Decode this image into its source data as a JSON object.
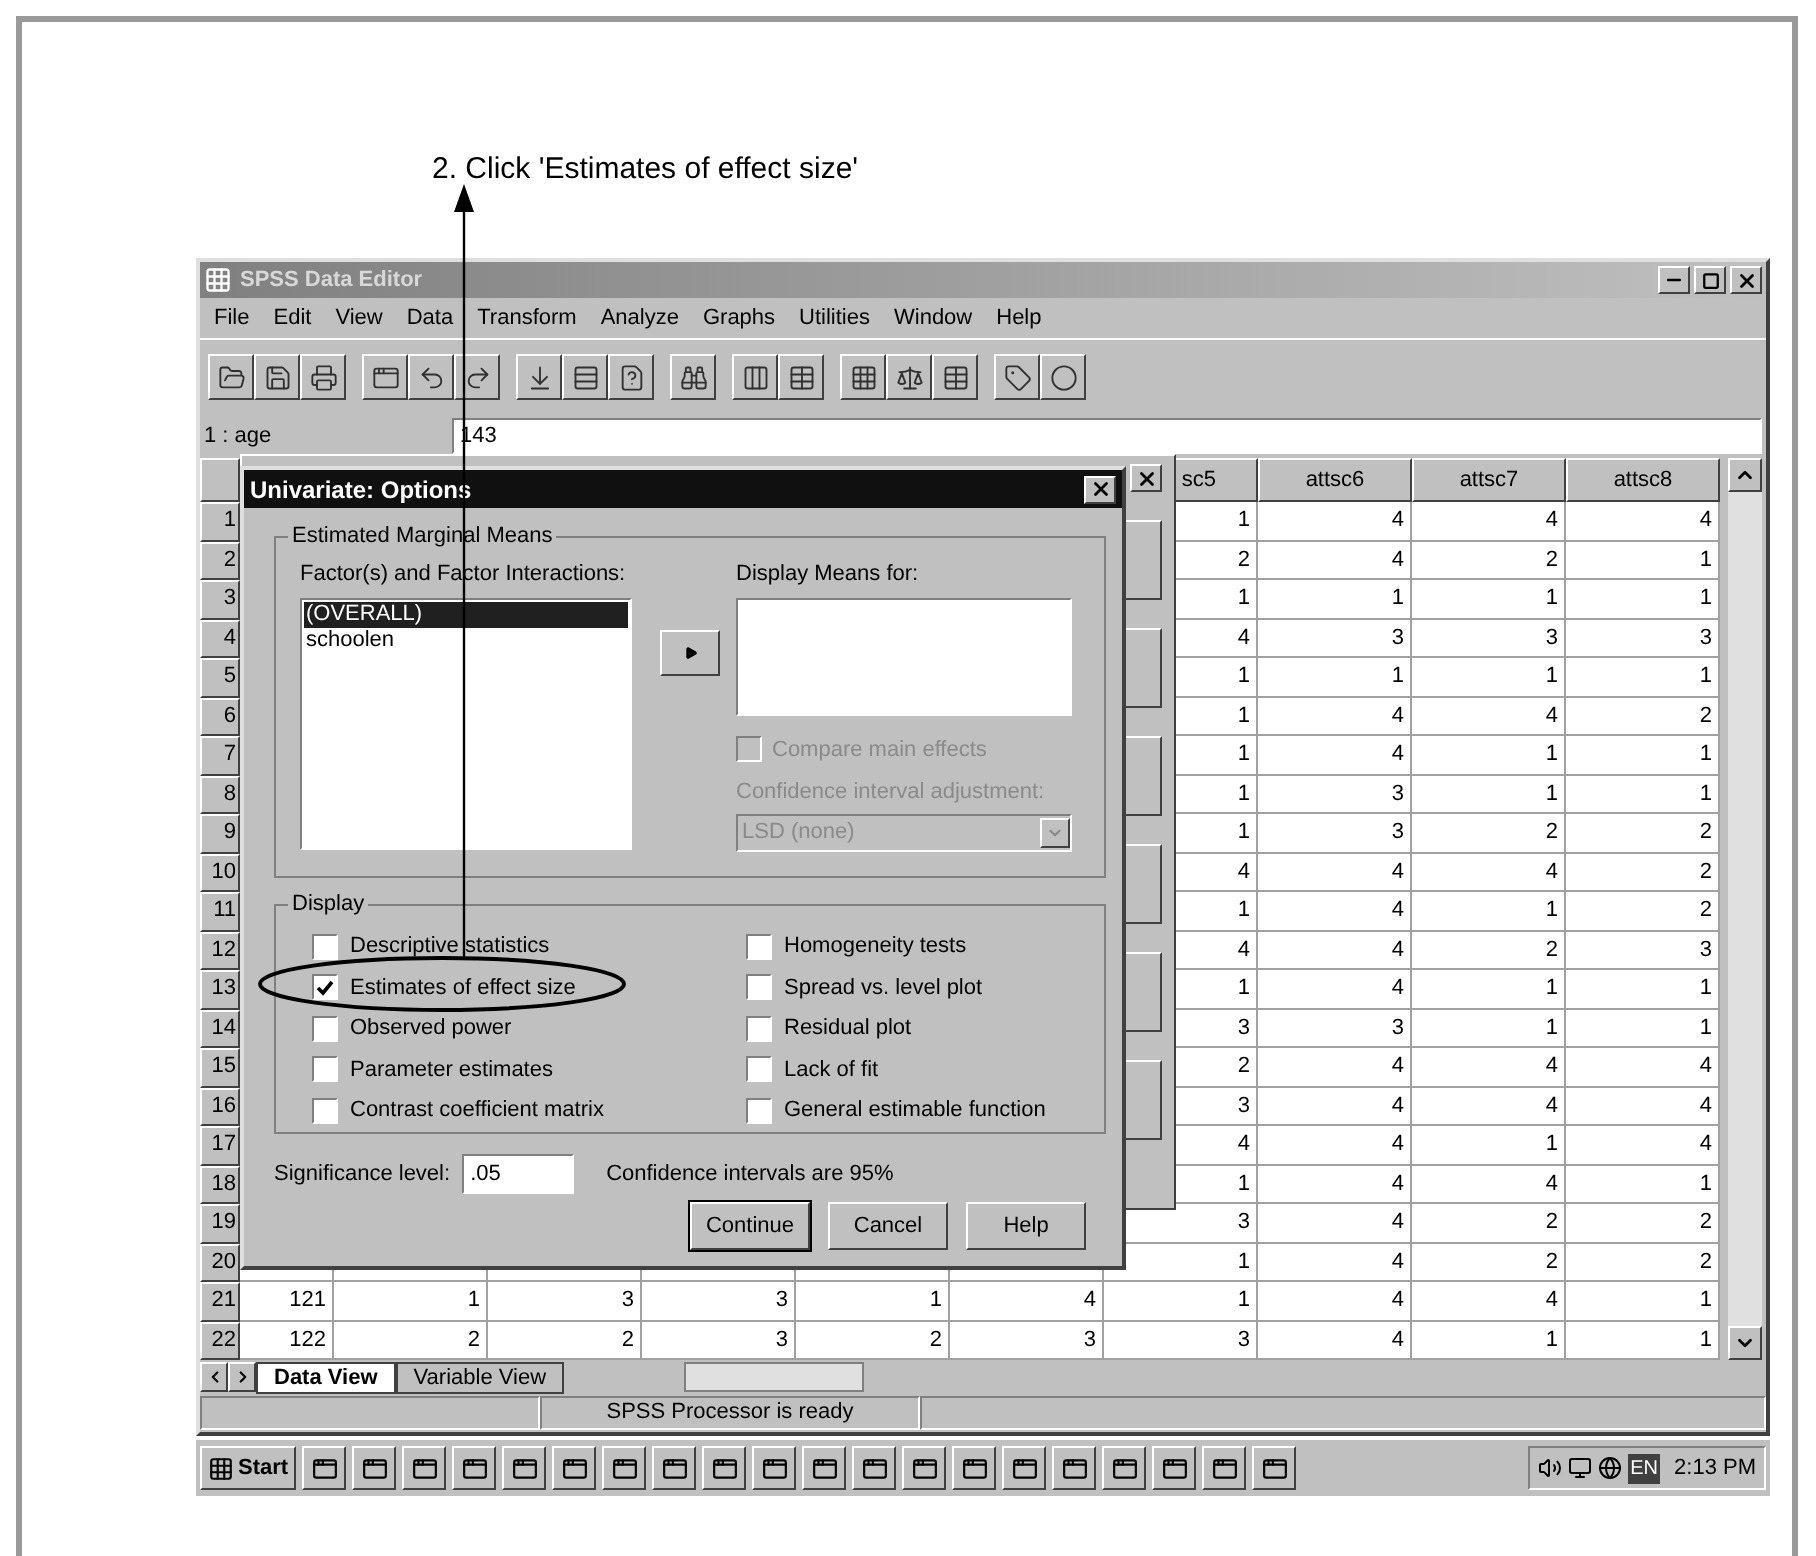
{
  "annotation": {
    "text": "2. Click 'Estimates of effect size'"
  },
  "window": {
    "title": "SPSS Data Editor"
  },
  "menu": [
    "File",
    "Edit",
    "View",
    "Data",
    "Transform",
    "Analyze",
    "Graphs",
    "Utilities",
    "Window",
    "Help"
  ],
  "cell_editor": {
    "cell": "1 : age",
    "value": "143"
  },
  "grid": {
    "columns": [
      "sc5",
      "attsc6",
      "attsc7",
      "attsc8"
    ],
    "rows": [
      {
        "number": "1",
        "cells": [
          "1",
          "4",
          "4",
          "4"
        ]
      },
      {
        "number": "2",
        "cells": [
          "2",
          "4",
          "2",
          "1"
        ]
      },
      {
        "number": "3",
        "cells": [
          "1",
          "1",
          "1",
          "1"
        ]
      },
      {
        "number": "4",
        "cells": [
          "4",
          "3",
          "3",
          "3"
        ]
      },
      {
        "number": "5",
        "cells": [
          "1",
          "1",
          "1",
          "1"
        ]
      },
      {
        "number": "6",
        "cells": [
          "1",
          "4",
          "4",
          "2"
        ]
      },
      {
        "number": "7",
        "cells": [
          "1",
          "4",
          "1",
          "1"
        ]
      },
      {
        "number": "8",
        "cells": [
          "1",
          "3",
          "1",
          "1"
        ]
      },
      {
        "number": "9",
        "cells": [
          "1",
          "3",
          "2",
          "2"
        ]
      },
      {
        "number": "10",
        "cells": [
          "4",
          "4",
          "4",
          "2"
        ]
      },
      {
        "number": "11",
        "cells": [
          "1",
          "4",
          "1",
          "2"
        ]
      },
      {
        "number": "12",
        "cells": [
          "4",
          "4",
          "2",
          "3"
        ]
      },
      {
        "number": "13",
        "cells": [
          "1",
          "4",
          "1",
          "1"
        ]
      },
      {
        "number": "14",
        "cells": [
          "3",
          "3",
          "1",
          "1"
        ]
      },
      {
        "number": "15",
        "cells": [
          "2",
          "4",
          "4",
          "4"
        ]
      },
      {
        "number": "16",
        "cells": [
          "3",
          "4",
          "4",
          "4"
        ]
      },
      {
        "number": "17",
        "cells": [
          "4",
          "4",
          "1",
          "4"
        ]
      },
      {
        "number": "18",
        "cells": [
          "1",
          "4",
          "4",
          "1"
        ]
      },
      {
        "number": "19",
        "cells": [
          "3",
          "4",
          "2",
          "2"
        ]
      },
      {
        "number": "20",
        "cells": [
          "1",
          "4",
          "2",
          "2"
        ]
      },
      {
        "number": "21",
        "cells": [
          "121",
          "1",
          "3",
          "3",
          "1",
          "4",
          "1",
          "4",
          "4",
          "1"
        ]
      },
      {
        "number": "22",
        "cells": [
          "122",
          "2",
          "2",
          "3",
          "2",
          "3",
          "3",
          "4",
          "1",
          "1"
        ]
      }
    ]
  },
  "sheet_tabs": [
    {
      "label": "Data View",
      "selected": true
    },
    {
      "label": "Variable View",
      "selected": false
    }
  ],
  "status_bar": {
    "text": "SPSS Processor  is ready"
  },
  "options_dialog": {
    "title": "Univariate: Options",
    "marginal_means": {
      "legend": "Estimated Marginal Means",
      "factors_label": "Factor(s) and Factor Interactions:",
      "factors": [
        {
          "label": "(OVERALL)",
          "selected": true
        },
        {
          "label": "schoolen",
          "selected": false
        }
      ],
      "display_means_label": "Display Means for:",
      "compare_main_effects": {
        "label": "Compare main effects",
        "checked": false,
        "disabled": true
      },
      "ci_adjustment_label": "Confidence interval adjustment:",
      "ci_adjustment": {
        "value": "LSD (none)",
        "disabled": true
      }
    },
    "display": {
      "legend": "Display",
      "left_options": [
        {
          "label": "Descriptive statistics",
          "checked": false
        },
        {
          "label": "Estimates of effect size",
          "checked": true
        },
        {
          "label": "Observed power",
          "checked": false
        },
        {
          "label": "Parameter estimates",
          "checked": false
        },
        {
          "label": "Contrast coefficient matrix",
          "checked": false
        }
      ],
      "right_options": [
        {
          "label": "Homogeneity tests",
          "checked": false
        },
        {
          "label": "Spread vs. level plot",
          "checked": false
        },
        {
          "label": "Residual plot",
          "checked": false
        },
        {
          "label": "Lack of fit",
          "checked": false
        },
        {
          "label": "General estimable function",
          "checked": false
        }
      ]
    },
    "significance": {
      "label": "Significance level:",
      "value": ".05"
    },
    "confidence_note": "Confidence intervals are 95%",
    "buttons": [
      {
        "label": "Continue",
        "default": true
      },
      {
        "label": "Cancel",
        "default": false
      },
      {
        "label": "Help",
        "default": false
      }
    ]
  },
  "taskbar": {
    "start": "Start",
    "language": "EN",
    "clock": "2:13 PM"
  }
}
